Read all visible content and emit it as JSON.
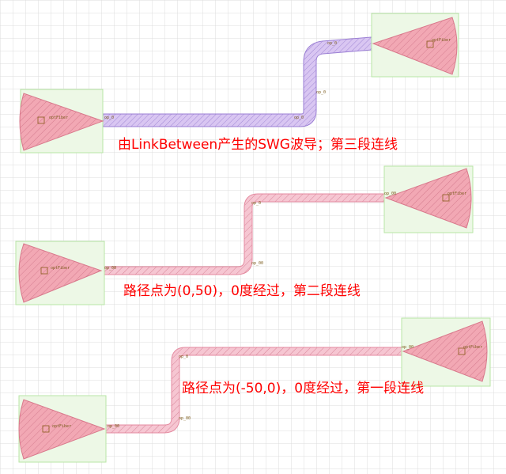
{
  "annotations": {
    "segment3": "由LinkBetween产生的SWG波导；第三段连线",
    "segment2": "路径点为(0,50)，0度经过，第二段连线",
    "segment1": "路径点为(-50,0)，0度经过，第一段连线"
  },
  "fiber": {
    "label": "optFiber"
  },
  "ports": {
    "seg3_a": "op_0",
    "seg3_b": "op_0",
    "seg3_c": "op_0",
    "seg3_d": "op_0",
    "seg2_a": "op_00",
    "seg2_b": "op_00",
    "seg2_c": "op_0",
    "seg2_d": "op_00",
    "seg1_a": "op_00",
    "seg1_b": "op_00",
    "seg1_c": "op_0",
    "seg1_d": "op_00"
  },
  "colors": {
    "grid": "#dcdcdc",
    "fiber_box": "#b8e6a6",
    "fiber_fill": "#f2a8b4",
    "fiber_dark": "#e07a8a",
    "swg_fill": "#d9c6f2",
    "swg_edge": "#9b7fd4",
    "wg_fill": "#f6c6d2",
    "wg_edge": "#e48aa0",
    "text": "#ff0000"
  }
}
